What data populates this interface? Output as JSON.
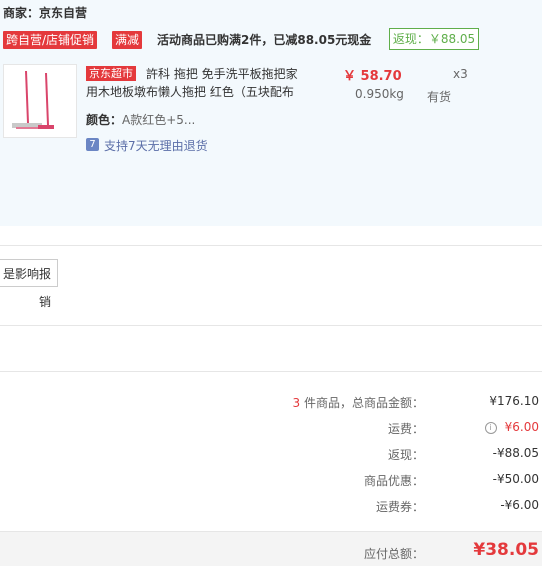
{
  "shop": {
    "merchant": "商家：京东自营",
    "tag_cross": "跨自营/店铺促销",
    "tag_full": "满减",
    "promo": "活动商品已购满2件，已减88.05元现金",
    "cashback_badge": "返现：￥88.05"
  },
  "product": {
    "market_tag": "京东超市",
    "name_line1": "許科 拖把 免手洗平板拖把家",
    "name_line2": "用木地板墩布懒人拖把 红色（五块配布",
    "price": "￥ 58.70",
    "qty": "x3",
    "weight": "0.950kg",
    "stock": "有货",
    "color_label": "颜色：",
    "color_value": "A款红色+5...",
    "return_icon": "7",
    "return_policy": "支持7天无理由退货"
  },
  "report_button": "是影响报销",
  "summary": {
    "count": "3",
    "count_suffix": " 件商品，总商品金额：",
    "total_goods": "¥176.10",
    "shipping_label": "运费：",
    "shipping_value": "¥6.00",
    "cashback_label": "返现：",
    "cashback_value": "-¥88.05",
    "discount_label": "商品优惠：",
    "discount_value": "-¥50.00",
    "coupon_label": "运费券：",
    "coupon_value": "-¥6.00",
    "payable_label": "应付总额：",
    "payable_value": "¥38.05"
  },
  "icons": {
    "info": "info-icon",
    "return": "return-policy-icon"
  },
  "colors": {
    "accent_red": "#e4393c",
    "cashback_green": "#5fae4a",
    "shop_bg": "#f3f9fd"
  }
}
